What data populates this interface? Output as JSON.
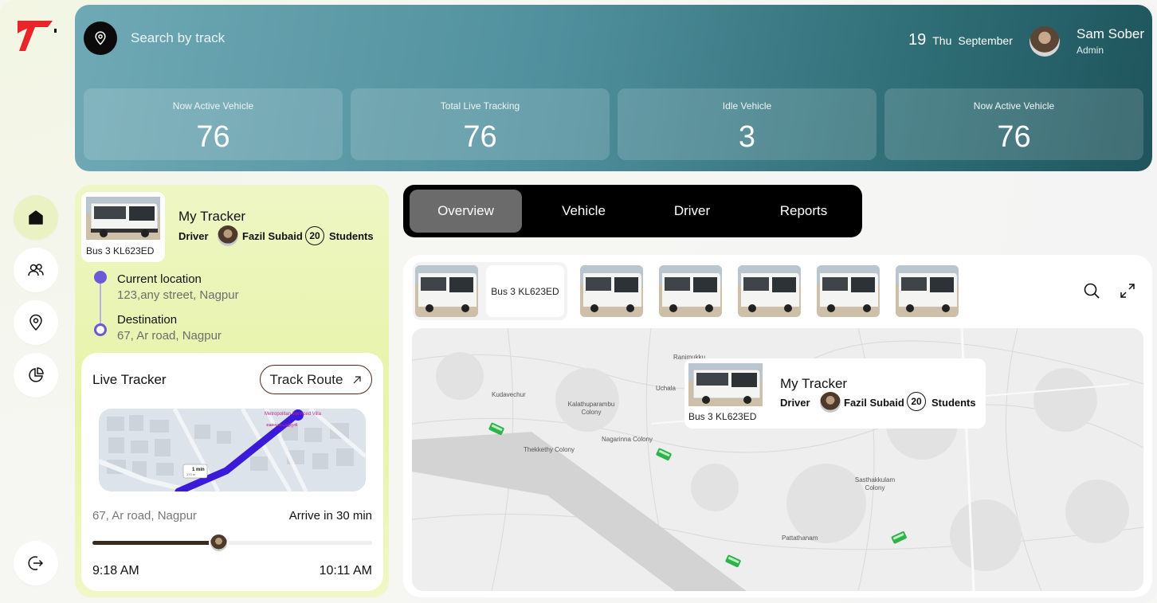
{
  "search": {
    "placeholder": "Search by track"
  },
  "date": {
    "day": "19",
    "weekday": "Thu",
    "month": "September"
  },
  "user": {
    "name": "Sam Sober",
    "role": "Admin"
  },
  "stats": [
    {
      "label": "Now Active Vehicle",
      "value": "76"
    },
    {
      "label": "Total Live Tracking",
      "value": "76"
    },
    {
      "label": "Idle Vehicle",
      "value": "3"
    },
    {
      "label": "Now Active Vehicle",
      "value": "76"
    }
  ],
  "sidebar": {
    "items": [
      {
        "icon": "home-icon",
        "active": true
      },
      {
        "icon": "users-icon",
        "active": false
      },
      {
        "icon": "location-pin-icon",
        "active": false
      },
      {
        "icon": "pie-chart-icon",
        "active": false
      }
    ],
    "logout_icon": "logout-icon"
  },
  "tracker": {
    "plate": "Bus 3 KL623ED",
    "title": "My Tracker",
    "driver_label": "Driver",
    "driver_name": "Fazil Subaid",
    "student_count": "20",
    "students_label": "Students",
    "current_title": "Current location",
    "current_address": "123,any street, Nagpur",
    "dest_title": "Destination",
    "dest_address": "67, Ar road, Nagpur"
  },
  "live": {
    "title": "Live Tracker",
    "track_button": "Track Route",
    "map_labels": {
      "place": "Metropolitan Serviced Villa",
      "place_local": "മെട്രോപൊളിറ്റൻ",
      "eta_badge": "1 min",
      "eta_dist": "170 m"
    },
    "address": "67, Ar road, Nagpur",
    "arrive": "Arrive in 30 min",
    "progress": 0.45,
    "start_time": "9:18 AM",
    "end_time": "10:11 AM"
  },
  "tabs": [
    {
      "label": "Overview",
      "active": true
    },
    {
      "label": "Vehicle",
      "active": false
    },
    {
      "label": "Driver",
      "active": false
    },
    {
      "label": "Reports",
      "active": false
    }
  ],
  "vehicles": {
    "selected_plate": "Bus 3 KL623ED",
    "count": 6
  },
  "map": {
    "labels": {
      "ranimukku": "Ranimukku",
      "kudavechur": "Kudavechur",
      "kalathu": "Kalathuparambu Colony",
      "uchala": "Uchala",
      "nagarinna": "Nagarinna Colony",
      "thekkethy": "Thekkethy Colony",
      "sasthakkulam": "Sasthakkulam Colony",
      "pattathanam": "Pattathanam"
    },
    "popup": {
      "plate": "Bus 3 KL623ED",
      "title": "My Tracker",
      "driver_label": "Driver",
      "driver_name": "Fazil Subaid",
      "student_count": "20",
      "students_label": "Students"
    }
  },
  "colors": {
    "accent_lime": "#e7f3a8",
    "header_teal": "#2d6b73",
    "route_purple": "#6a5ad8",
    "bus_green": "#2fb24a"
  }
}
